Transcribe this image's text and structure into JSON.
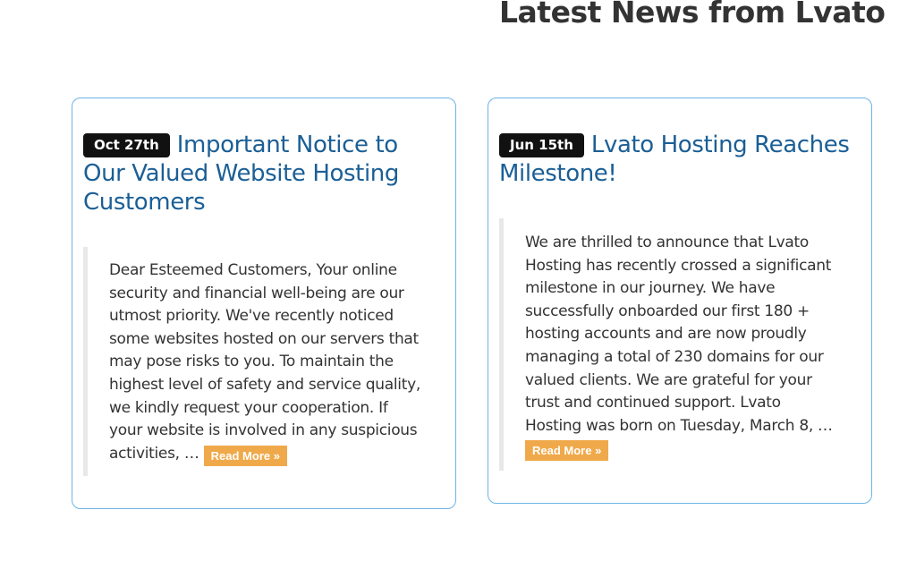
{
  "section": {
    "title": "Latest News from Lvato"
  },
  "posts": [
    {
      "date": "Oct 27th",
      "title": "Important Notice to Our Valued Website Hosting Customers",
      "excerpt": "Dear Esteemed Customers, Your online security and financial well-being are our utmost priority. We've recently noticed some websites hosted on our servers that may pose risks to you. To maintain the highest level of safety and service quality, we kindly request your cooperation. If your website is involved in any suspicious activities, … ",
      "read_more": "Read More »"
    },
    {
      "date": "Jun 15th",
      "title": "Lvato Hosting Reaches Milestone!",
      "excerpt": "We are thrilled to announce that Lvato Hosting has recently crossed a significant milestone in our journey. We have successfully onboarded our first 180 + hosting accounts and are now proudly managing a total of 230 domains for our valued clients. We are grateful for your trust and continued support. Lvato Hosting was born on Tuesday, March 8, … ",
      "read_more": "Read More »"
    }
  ],
  "colors": {
    "title_text": "#333333",
    "heading_link": "#1b5f96",
    "card_border": "#6cb4e4",
    "badge_bg": "#111111",
    "read_more_bg": "#f0a94a"
  }
}
